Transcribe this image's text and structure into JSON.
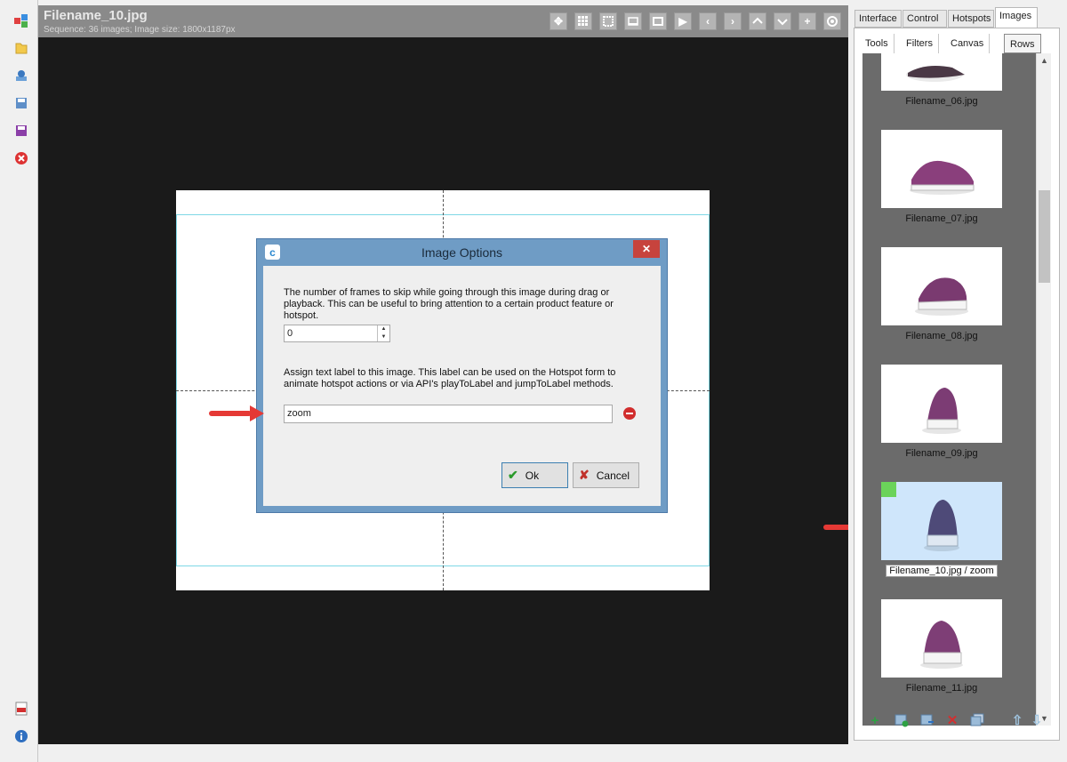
{
  "header": {
    "title": "Filename_10.jpg",
    "subtitle": "Sequence: 36 images; Image size: 1800x1187px",
    "toolbar": [
      "move-icon",
      "grid-icon",
      "select-icon",
      "fit-icon",
      "frame-icon",
      "play-icon",
      "prev-icon",
      "next-icon",
      "up-icon",
      "down-icon",
      "zoom-in-icon",
      "settings-icon"
    ]
  },
  "left_toolbar": [
    "app-icon",
    "open-folder-icon",
    "upload-icon",
    "save-as-icon",
    "save-icon",
    "close-icon",
    "pdf-icon",
    "info-icon"
  ],
  "dialog": {
    "title": "Image Options",
    "skip_text": "The number of frames to skip while going through this image during drag or playback. This can be useful to bring attention to a certain product feature or hotspot.",
    "skip_value": "0",
    "label_text": "Assign text label to this image. This label can be used on the Hotspot form to animate hotspot actions or via API's playToLabel and jumpToLabel methods.",
    "label_value": "zoom",
    "ok_label": "Ok",
    "cancel_label": "Cancel"
  },
  "right_panel": {
    "tabs": [
      "Interface",
      "Control",
      "Hotspots",
      "Images"
    ],
    "active_tab": "Images",
    "subtabs": [
      "Tools",
      "Filters",
      "Canvas",
      "Rows"
    ],
    "active_subtab": "Rows",
    "thumbnails": [
      {
        "caption": "Filename_06.jpg"
      },
      {
        "caption": "Filename_07.jpg"
      },
      {
        "caption": "Filename_08.jpg"
      },
      {
        "caption": "Filename_09.jpg"
      },
      {
        "caption": "Filename_10.jpg / zoom",
        "selected": true
      },
      {
        "caption": "Filename_11.jpg"
      }
    ],
    "bottom_actions": [
      "add-icon",
      "add-image-icon",
      "import-icon",
      "delete-icon",
      "duplicate-icon",
      "move-up-icon",
      "move-down-icon"
    ]
  },
  "colors": {
    "header_bg": "#8a8a8a",
    "viewport_bg": "#1a1a1a",
    "dialog_frame": "#6f9cc5",
    "close_red": "#c7433d",
    "selection_blue": "#cfe6fb",
    "label_marker_green": "#6bd35a",
    "arrow_red": "#e53935"
  }
}
